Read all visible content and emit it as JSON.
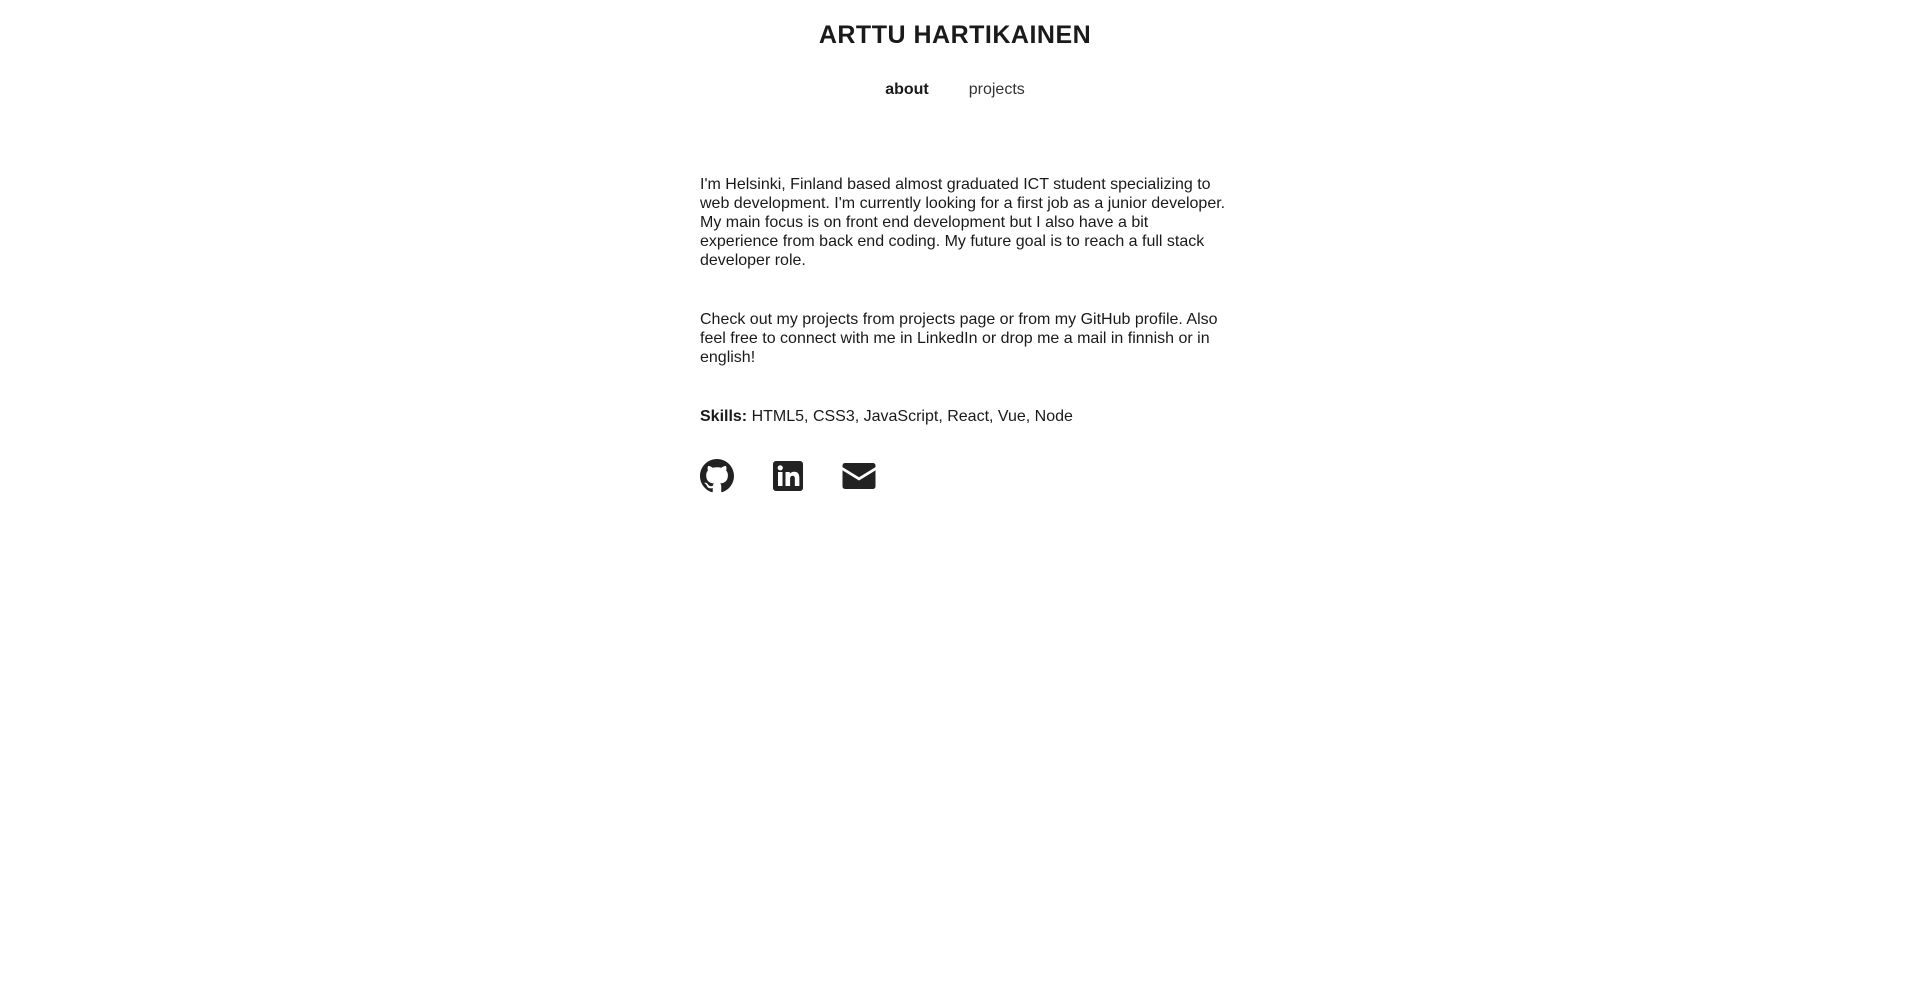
{
  "header": {
    "title": "ARTTU HARTIKAINEN"
  },
  "nav": {
    "items": [
      {
        "label": "about",
        "active": true
      },
      {
        "label": "projects",
        "active": false
      }
    ]
  },
  "about": {
    "intro": "I'm Helsinki, Finland based almost graduated ICT student specializing to web development. I'm currently looking for a first job as a junior developer. My main focus is on front end development but I also have a bit experience from back end coding. My future goal is to reach a full stack developer role.",
    "cta": "Check out my projects from projects page or from my GitHub profile. Also feel free to connect with me in LinkedIn or drop me a mail in finnish or in english!",
    "skills_label": "Skills:",
    "skills_value": "HTML5, CSS3, JavaScript, React, Vue, Node"
  },
  "social": {
    "icons": [
      "github-icon",
      "linkedin-icon",
      "mail-icon"
    ]
  },
  "colors": {
    "text": "#1a1a1a",
    "background": "#ffffff"
  }
}
